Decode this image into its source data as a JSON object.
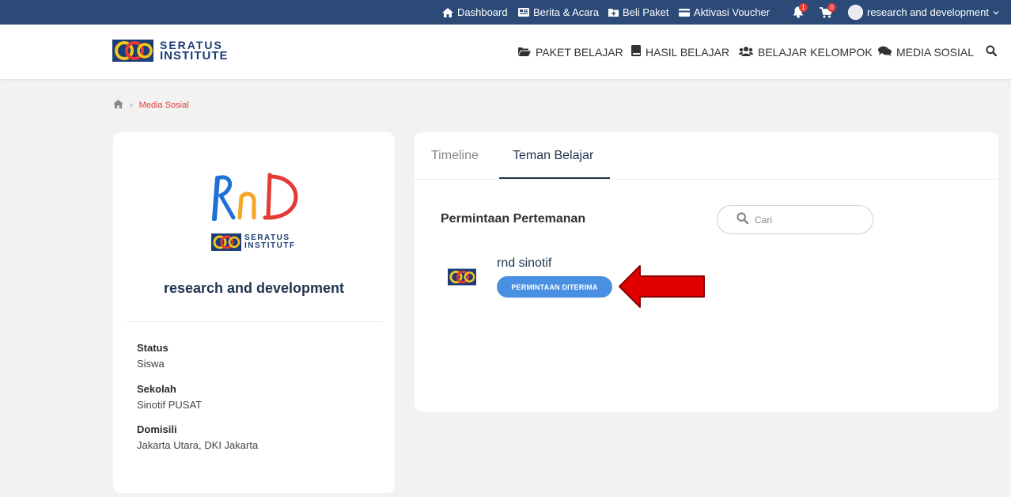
{
  "topbar": {
    "dashboard": "Dashboard",
    "news": "Berita & Acara",
    "buy": "Beli Paket",
    "voucher": "Aktivasi Voucher",
    "notif_count": "1",
    "cart_count": "0",
    "user": "research and development"
  },
  "brand": {
    "line1": "SERATUS",
    "line2": "INSTITUTE"
  },
  "nav": {
    "paket": "PAKET BELAJAR",
    "hasil": "HASIL BELAJAR",
    "kelompok": "BELAJAR KELOMPOK",
    "media": "MEDIA SOSIAL"
  },
  "breadcrumb": {
    "current": "Media Sosial"
  },
  "profile": {
    "logo_text": "RnD",
    "sub_logo_line1": "SERATUS",
    "sub_logo_line2": "INSTITUTF",
    "name": "research and development",
    "fields": [
      {
        "label": "Status",
        "value": "Siswa"
      },
      {
        "label": "Sekolah",
        "value": "Sinotif PUSAT"
      },
      {
        "label": "Domisili",
        "value": "Jakarta Utara, DKI Jakarta"
      }
    ]
  },
  "tabs": [
    {
      "label": "Timeline"
    },
    {
      "label": "Teman Belajar"
    }
  ],
  "requests": {
    "title": "Permintaan Pertemanan",
    "search_placeholder": "Cari",
    "items": [
      {
        "name": "rnd sinotif",
        "button": "PERMINTAAN DITERIMA"
      }
    ]
  },
  "colors": {
    "topbar": "#2b4a78",
    "accent_button": "#4a90e2",
    "breadcrumb_active": "#e53935",
    "arrow": "#e00000"
  }
}
